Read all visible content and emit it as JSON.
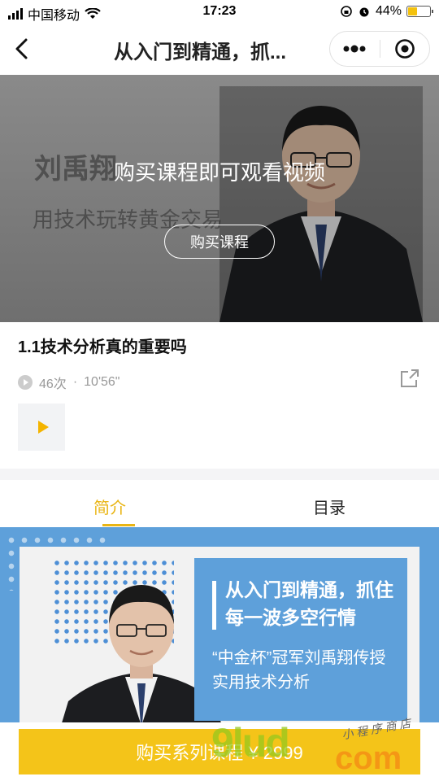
{
  "status_bar": {
    "carrier": "中国移动",
    "time": "17:23",
    "battery_percent": "44%",
    "battery_level": 0.44
  },
  "nav": {
    "title": "从入门到精通，抓...",
    "more_icon": "more-dots-icon",
    "close_icon": "target-circle-icon"
  },
  "video": {
    "poster_name": "刘禹翔",
    "poster_slogan": "用技术玩转黄金交易",
    "overlay_text": "购买课程即可观看视频",
    "buy_button": "购买课程"
  },
  "lesson": {
    "title": "1.1技术分析真的重要吗",
    "plays": "46次",
    "separator": "·",
    "duration": "10'56\""
  },
  "tabs": [
    {
      "label": "简介",
      "active": true
    },
    {
      "label": "目录",
      "active": false
    }
  ],
  "intro_banner": {
    "headline": "从入门到精通，抓住每一波多空行情",
    "subline": "“中金杯”冠军刘禹翔传授实用技术分析"
  },
  "bottom": {
    "buy_series": "购买系列课程 ¥ 2999"
  },
  "watermark": {
    "big": "9lud",
    "com": "com",
    "small": "小 程 序 商 店"
  },
  "colors": {
    "accent": "#e9b514",
    "buy_button": "#f4c419",
    "banner_blue": "#5ea0da"
  }
}
